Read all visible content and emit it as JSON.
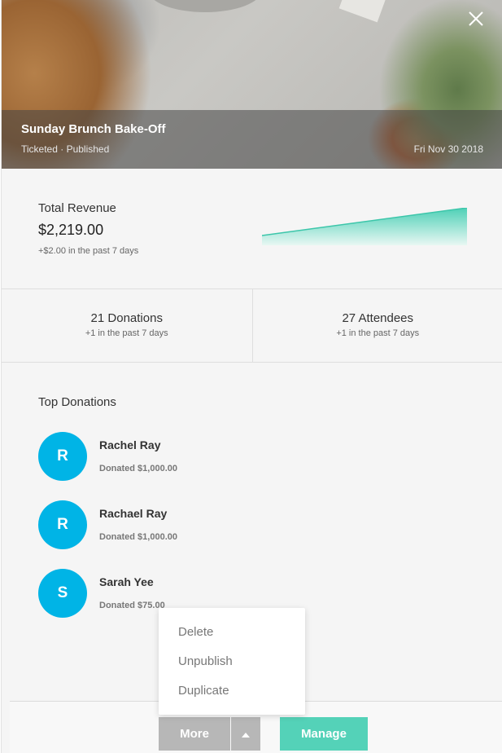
{
  "hero": {
    "title": "Sunday Brunch Bake-Off",
    "subtitle": "Ticketed · Published",
    "date": "Fri Nov 30 2018"
  },
  "revenue": {
    "label": "Total Revenue",
    "amount": "$2,219.00",
    "delta": "+$2.00 in the past 7 days",
    "sparkline_color": "#4ed0b6"
  },
  "stats": [
    {
      "value": "21 Donations",
      "sub": "+1 in the past 7 days"
    },
    {
      "value": "27 Attendees",
      "sub": "+1 in the past 7 days"
    }
  ],
  "top_donations": {
    "heading": "Top Donations",
    "donors": [
      {
        "initial": "R",
        "name": "Rachel Ray",
        "amount": "Donated $1,000.00"
      },
      {
        "initial": "R",
        "name": "Rachael Ray",
        "amount": "Donated $1,000.00"
      },
      {
        "initial": "S",
        "name": "Sarah Yee",
        "amount": "Donated $75.00"
      }
    ]
  },
  "menu": {
    "items": [
      "Delete",
      "Unpublish",
      "Duplicate"
    ]
  },
  "footer": {
    "more_label": "More",
    "manage_label": "Manage"
  },
  "colors": {
    "avatar": "#00b4e6",
    "manage": "#54d2b8",
    "more": "#b7b7b7"
  },
  "icons": {
    "close": "close-icon",
    "caret": "caret-up-icon"
  }
}
